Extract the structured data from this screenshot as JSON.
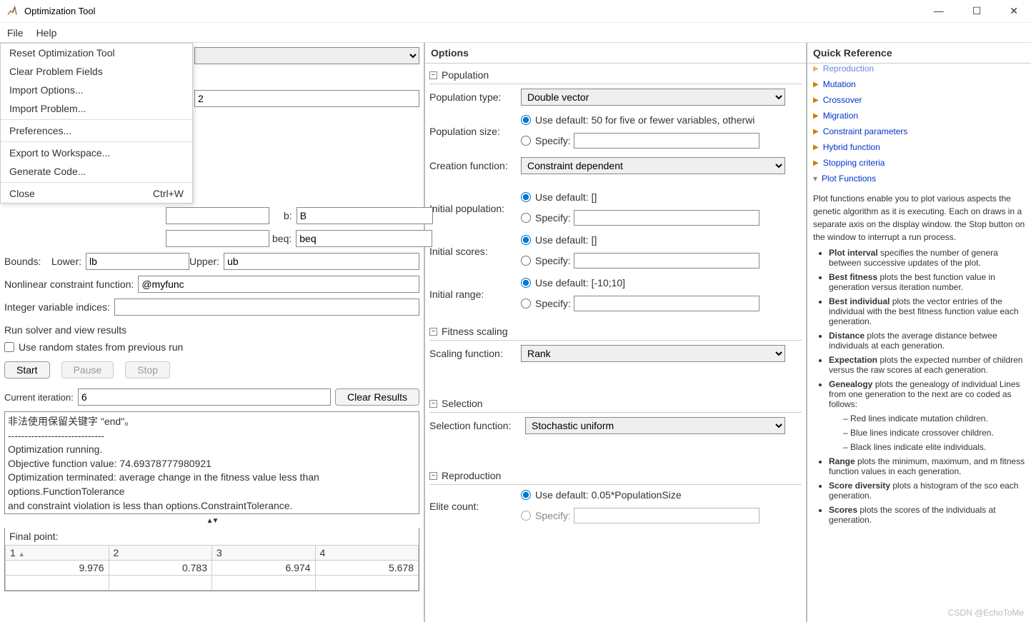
{
  "window": {
    "title": "Optimization Tool"
  },
  "menubar": {
    "file": "File",
    "help": "Help"
  },
  "file_menu": {
    "reset": "Reset Optimization Tool",
    "clear": "Clear Problem Fields",
    "import_options": "Import Options...",
    "import_problem": "Import Problem...",
    "preferences": "Preferences...",
    "export": "Export to Workspace...",
    "generate": "Generate Code...",
    "close": "Close",
    "close_shortcut": "Ctrl+W"
  },
  "problem": {
    "nvars_value": "2",
    "b_label": "b:",
    "b_value": "B",
    "beq_label": "beq:",
    "beq_value": "beq",
    "bounds_label": "Bounds:",
    "lower_label": "Lower:",
    "lower_value": "lb",
    "upper_label": "Upper:",
    "upper_value": "ub",
    "nonlcon_label": "Nonlinear constraint function:",
    "nonlcon_value": "@myfunc",
    "intcon_label": "Integer variable indices:",
    "intcon_value": ""
  },
  "run": {
    "header": "Run solver and view results",
    "checkbox": "Use random states from previous run",
    "start": "Start",
    "pause": "Pause",
    "stop": "Stop",
    "iter_label": "Current iteration:",
    "iter_value": "6",
    "clear": "Clear Results",
    "log": [
      "非法使用保留关键字 \"end\"。",
      "-----------------------------",
      "Optimization running.",
      "Objective function value: 74.69378777980921",
      "Optimization terminated: average change in the fitness value less than options.FunctionTolerance",
      "and constraint violation is less than options.ConstraintTolerance."
    ],
    "final": {
      "title": "Final point:",
      "headers": [
        "1",
        "2",
        "3",
        "4"
      ],
      "values": [
        "9.976",
        "0.783",
        "6.974",
        "5.678"
      ]
    }
  },
  "options": {
    "header": "Options",
    "population": {
      "title": "Population",
      "type_label": "Population type:",
      "type_value": "Double vector",
      "size_label": "Population size:",
      "size_default": "Use default: 50 for five or fewer variables, otherwi",
      "specify": "Specify:",
      "creation_label": "Creation function:",
      "creation_value": "Constraint dependent",
      "initpop_label": "Initial population:",
      "initpop_default": "Use default: []",
      "initscores_label": "Initial scores:",
      "initscores_default": "Use default: []",
      "initrange_label": "Initial range:",
      "initrange_default": "Use default: [-10;10]"
    },
    "fitness": {
      "title": "Fitness scaling",
      "label": "Scaling function:",
      "value": "Rank"
    },
    "selection": {
      "title": "Selection",
      "label": "Selection function:",
      "value": "Stochastic uniform"
    },
    "reproduction": {
      "title": "Reproduction",
      "elite_label": "Elite count:",
      "elite_default": "Use default: 0.05*PopulationSize",
      "specify": "Specify:"
    }
  },
  "reference": {
    "header": "Quick Reference",
    "links": [
      "Reproduction",
      "Mutation",
      "Crossover",
      "Migration",
      "Constraint parameters",
      "Hybrid function",
      "Stopping criteria"
    ],
    "current": "Plot Functions",
    "intro": "Plot functions enable you to plot various aspects the genetic algorithm as it is executing. Each on draws in a separate axis on the display window. the Stop button on the window to interrupt a run process.",
    "bullets": [
      {
        "b": "Plot interval",
        "t": " specifies the number of genera between successive updates of the plot."
      },
      {
        "b": "Best fitness",
        "t": " plots the best function value in generation versus iteration number."
      },
      {
        "b": "Best individual",
        "t": " plots the vector entries of the individual with the best fitness function value each generation."
      },
      {
        "b": "Distance",
        "t": " plots the average distance betwee individuals at each generation."
      },
      {
        "b": "Expectation",
        "t": " plots the expected number of children versus the raw scores at each generation."
      },
      {
        "b": "Genealogy",
        "t": " plots the genealogy of individual Lines from one generation to the next are co coded as follows:"
      },
      {
        "b": "Range",
        "t": " plots the minimum, maximum, and m fitness function values in each generation."
      },
      {
        "b": "Score diversity",
        "t": " plots a histogram of the sco each generation."
      },
      {
        "b": "Scores",
        "t": " plots the scores of the individuals at generation."
      }
    ],
    "sub": [
      "Red lines indicate mutation children.",
      "Blue lines indicate crossover children.",
      "Black lines indicate elite individuals."
    ]
  },
  "watermark": "CSDN @EchoToMe"
}
